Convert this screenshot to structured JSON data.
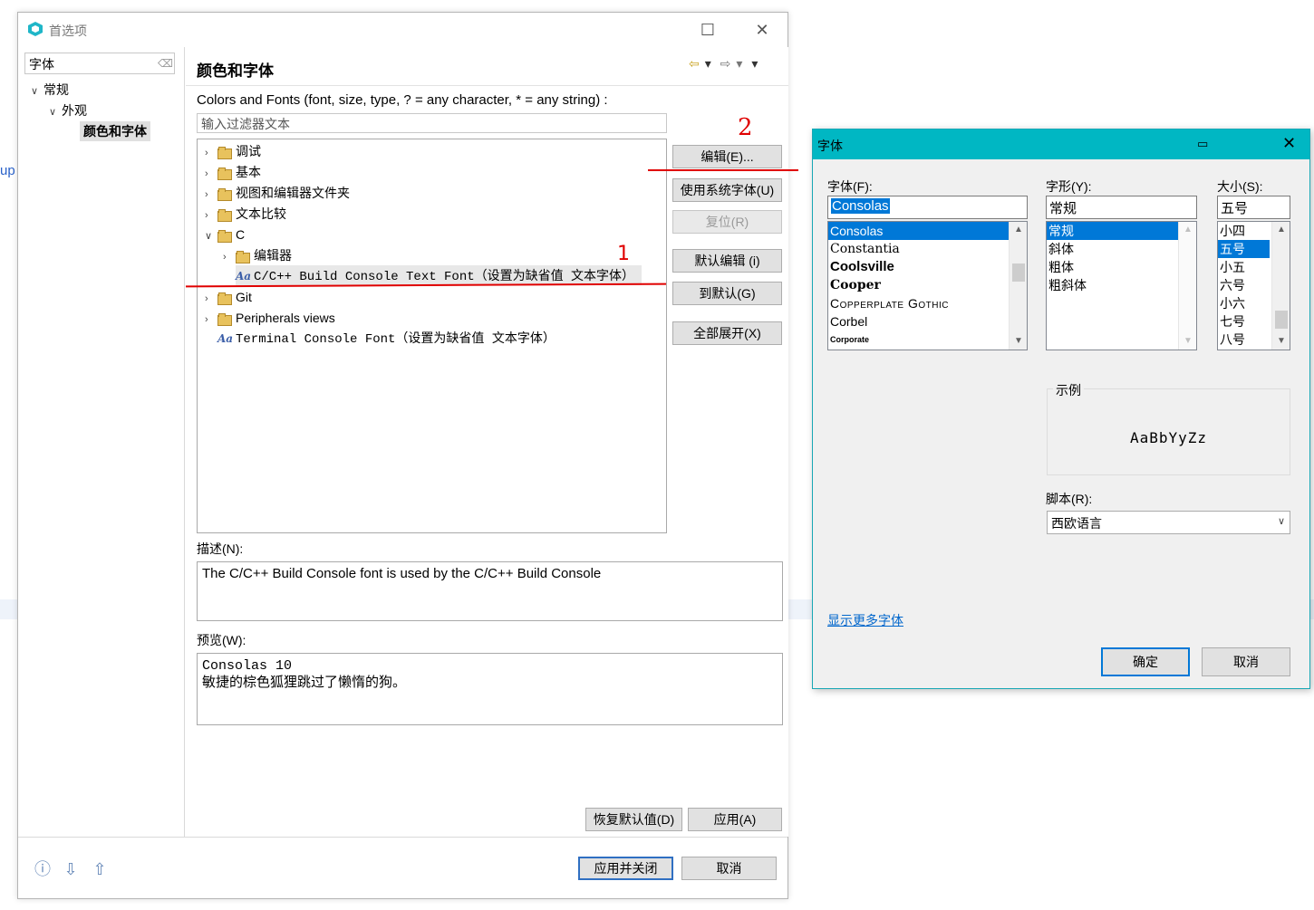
{
  "background": {
    "partial_text": "up"
  },
  "preferences": {
    "window_title": "首选项",
    "left": {
      "filter_value": "字体",
      "tree": [
        {
          "label": "常规"
        },
        {
          "label": "外观"
        },
        {
          "label": "颜色和字体"
        }
      ]
    },
    "page_title": "颜色和字体",
    "description": "Colors and Fonts (font, size, type, ? = any character, * = any string) :",
    "filter_placeholder": "输入过滤器文本",
    "tree_items": [
      "调试",
      "基本",
      "视图和编辑器文件夹",
      "文本比较",
      "C",
      "编辑器",
      "C/C++ Build Console Text Font（设置为缺省值 文本字体）",
      "Git",
      "Peripherals views",
      "Terminal Console Font（设置为缺省值 文本字体）"
    ],
    "buttons": {
      "edit": "编辑(E)...",
      "use_system_font": "使用系统字体(U)",
      "reset": "复位(R)",
      "edit_default": "默认编辑 (i)",
      "go_to_default": "到默认(G)",
      "expand_all": "全部展开(X)",
      "restore_defaults": "恢复默认值(D)",
      "apply": "应用(A)",
      "apply_and_close": "应用并关闭",
      "cancel": "取消"
    },
    "desc_label": "描述(N):",
    "desc_text": "The C/C++ Build Console font is used by the C/C++ Build Console",
    "preview_label": "预览(W):",
    "preview_line1": "Consolas 10",
    "preview_line2": "敏捷的棕色狐狸跳过了懒惰的狗。"
  },
  "annotations": {
    "one": "1",
    "two": "2"
  },
  "font_dialog": {
    "title": "字体",
    "font_label": "字体(F):",
    "font_value": "Consolas",
    "fonts": [
      "Consolas",
      "Constantia",
      "Coolsville",
      "Cooper",
      "Copperplate Gothic",
      "Corbel",
      "Corporate"
    ],
    "style_label": "字形(Y):",
    "style_value": "常规",
    "styles": [
      "常规",
      "斜体",
      "粗体",
      "粗斜体"
    ],
    "size_label": "大小(S):",
    "size_value": "五号",
    "sizes": [
      "小四",
      "五号",
      "小五",
      "六号",
      "小六",
      "七号",
      "八号"
    ],
    "sample_label": "示例",
    "sample_text": "AaBbYyZz",
    "script_label": "脚本(R):",
    "script_value": "西欧语言",
    "more_fonts": "显示更多字体",
    "ok": "确定",
    "cancel": "取消"
  }
}
